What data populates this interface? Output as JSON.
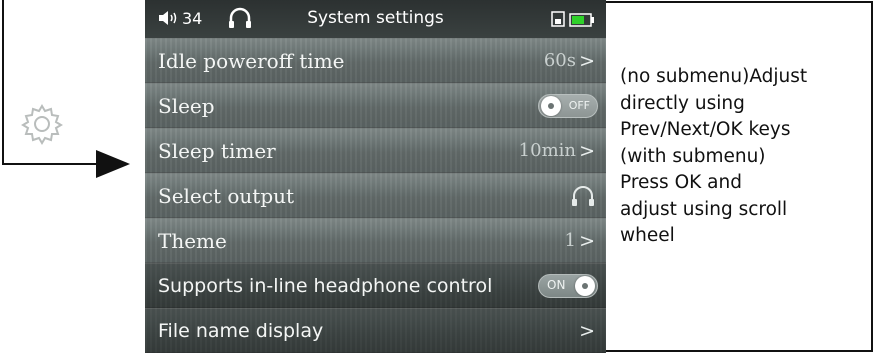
{
  "statusbar": {
    "volume_icon": "speaker-icon",
    "volume_level": "34",
    "headphone_icon": "headphone-icon",
    "title": "System settings",
    "sd_icon": "sd-card-icon",
    "battery_icon": "battery-icon",
    "battery_color": "#2fd12a"
  },
  "settings": {
    "idle_poweroff": {
      "label": "Idle poweroff time",
      "value": "60s"
    },
    "sleep": {
      "label": "Sleep",
      "toggle_text": "OFF",
      "state": "off"
    },
    "sleep_timer": {
      "label": "Sleep timer",
      "value": "10min"
    },
    "select_output": {
      "label": "Select output",
      "value_icon": "headphone-icon"
    },
    "theme": {
      "label": "Theme",
      "value": "1"
    },
    "inline_control": {
      "label": "Supports in-line headphone control",
      "toggle_text": "ON",
      "state": "on"
    },
    "file_name_display": {
      "label": "File name display"
    }
  },
  "chevron": ">",
  "description": {
    "line1": "(no submenu)Adjust",
    "line2": "directly using",
    "line3": "Prev/Next/OK keys",
    "line4": "(with submenu)",
    "line5": "Press OK and",
    "line6": "adjust using scroll",
    "line7": "wheel"
  },
  "gear_icon": "gear-icon"
}
